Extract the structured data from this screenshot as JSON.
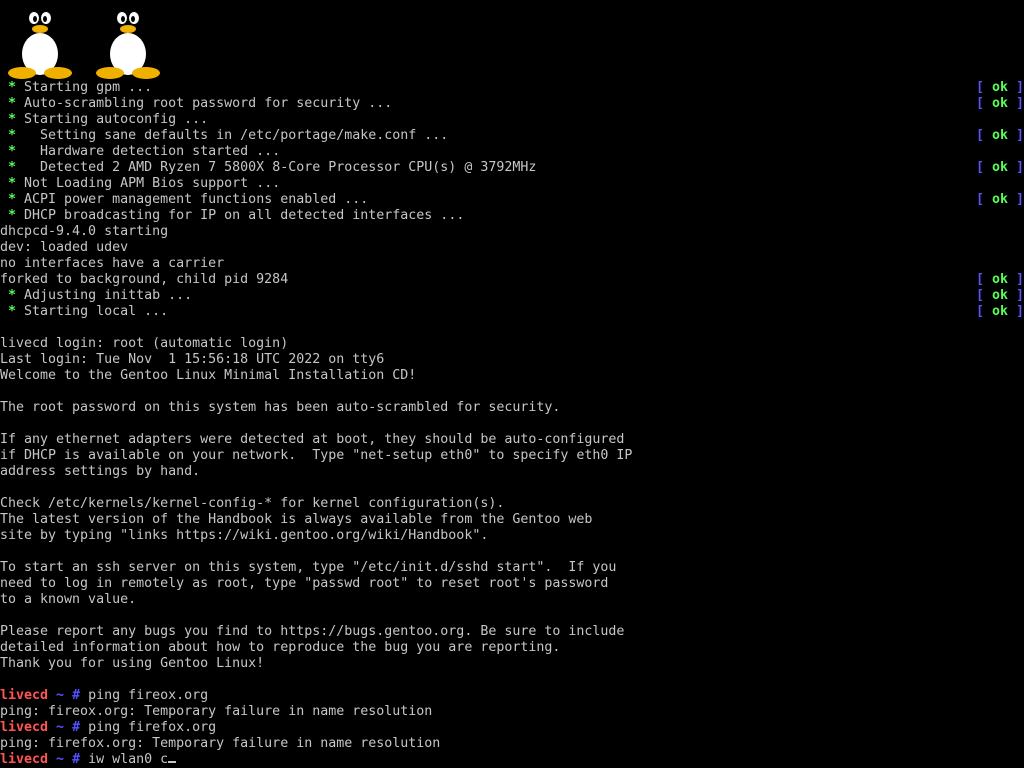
{
  "colors": {
    "background": "#000000",
    "text": "#c6c6c6",
    "star": "#54ff54",
    "bracket": "#5454ff",
    "ok": "#54ff54",
    "prompt_host": "#ff5454"
  },
  "logos": [
    {
      "icon": "tux-penguin-icon"
    },
    {
      "icon": "tux-penguin-icon"
    }
  ],
  "status": {
    "open": "[ ",
    "ok": "ok",
    "close": " ]"
  },
  "boot_lines": [
    {
      "star": " * ",
      "text": "Starting gpm ...",
      "ok": true
    },
    {
      "star": " * ",
      "text": "Auto-scrambling root password for security ...",
      "ok": true
    },
    {
      "star": " * ",
      "text": "Starting autoconfig ...",
      "ok": false
    },
    {
      "star": " *   ",
      "text": "Setting sane defaults in /etc/portage/make.conf ...",
      "ok": true
    },
    {
      "star": " *   ",
      "text": "Hardware detection started ...",
      "ok": false
    },
    {
      "star": " *   ",
      "text": "Detected 2 AMD Ryzen 7 5800X 8-Core Processor CPU(s) @ 3792MHz",
      "ok": true
    },
    {
      "star": " * ",
      "text": "Not Loading APM Bios support ...",
      "ok": false
    },
    {
      "star": " * ",
      "text": "ACPI power management functions enabled ...",
      "ok": true
    },
    {
      "star": " * ",
      "text": "DHCP broadcasting for IP on all detected interfaces ...",
      "ok": false
    },
    {
      "star": "",
      "text": "dhcpcd-9.4.0 starting",
      "ok": false
    },
    {
      "star": "",
      "text": "dev: loaded udev",
      "ok": false
    },
    {
      "star": "",
      "text": "no interfaces have a carrier",
      "ok": false
    },
    {
      "star": "",
      "text": "forked to background, child pid 9284",
      "ok": true
    },
    {
      "star": " * ",
      "text": "Adjusting inittab ...",
      "ok": true
    },
    {
      "star": " * ",
      "text": "Starting local ...",
      "ok": true
    }
  ],
  "motd_lines": [
    "",
    "livecd login: root (automatic login)",
    "Last login: Tue Nov  1 15:56:18 UTC 2022 on tty6",
    "Welcome to the Gentoo Linux Minimal Installation CD!",
    "",
    "The root password on this system has been auto-scrambled for security.",
    "",
    "If any ethernet adapters were detected at boot, they should be auto-configured",
    "if DHCP is available on your network.  Type \"net-setup eth0\" to specify eth0 IP",
    "address settings by hand.",
    "",
    "Check /etc/kernels/kernel-config-* for kernel configuration(s).",
    "The latest version of the Handbook is always available from the Gentoo web",
    "site by typing \"links https://wiki.gentoo.org/wiki/Handbook\".",
    "",
    "To start an ssh server on this system, type \"/etc/init.d/sshd start\".  If you",
    "need to log in remotely as root, type \"passwd root\" to reset root's password",
    "to a known value.",
    "",
    "Please report any bugs you find to https://bugs.gentoo.org. Be sure to include",
    "detailed information about how to reproduce the bug you are reporting.",
    "Thank you for using Gentoo Linux!",
    ""
  ],
  "prompt": {
    "host": "livecd",
    "path": " ~ ",
    "symbol": "# "
  },
  "session": [
    {
      "type": "command",
      "text": "ping fireox.org"
    },
    {
      "type": "output",
      "text": "ping: fireox.org: Temporary failure in name resolution"
    },
    {
      "type": "command",
      "text": "ping firefox.org"
    },
    {
      "type": "output",
      "text": "ping: firefox.org: Temporary failure in name resolution"
    },
    {
      "type": "input",
      "text": "iw wlan0 c"
    }
  ]
}
